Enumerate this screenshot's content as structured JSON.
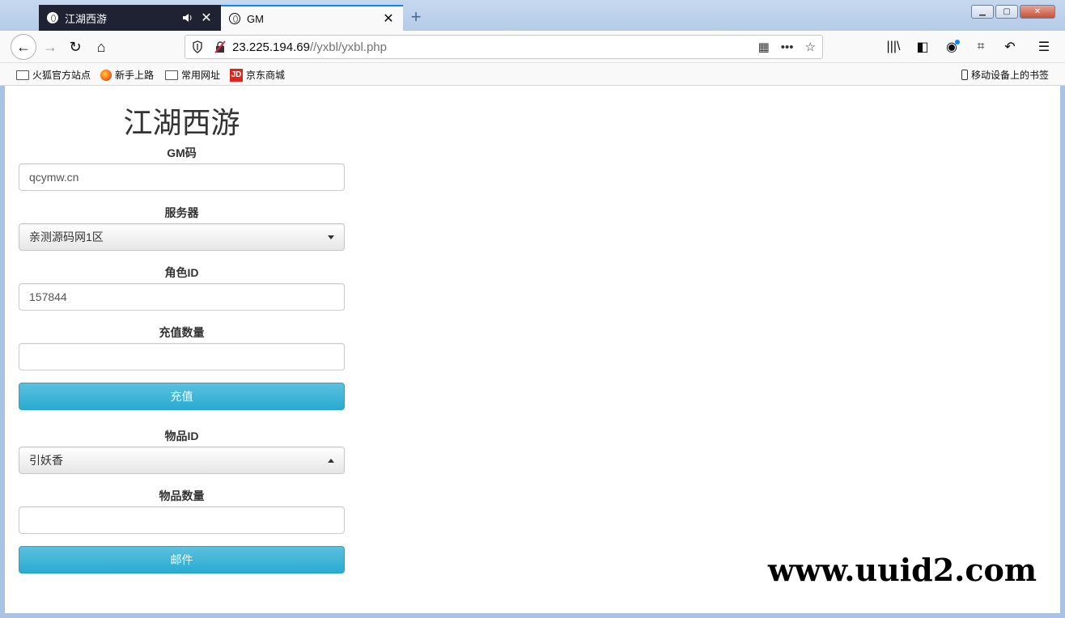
{
  "tabs": [
    {
      "title": "江湖西游",
      "active": false
    },
    {
      "title": "GM",
      "active": true
    }
  ],
  "url": {
    "host": "23.225.194.69",
    "path": "//yxbl/yxbl.php"
  },
  "bookmarks": [
    {
      "label": "火狐官方站点",
      "icon": "folder-icon"
    },
    {
      "label": "新手上路",
      "icon": "firefox-icon"
    },
    {
      "label": "常用网址",
      "icon": "folder-icon"
    },
    {
      "label": "京东商城",
      "icon": "jd-icon"
    }
  ],
  "mobile_bookmarks": "移动设备上的书签",
  "jd_icon_text": "JD",
  "page": {
    "title": "江湖西游",
    "gm_label": "GM码",
    "gm_value": "qcymw.cn",
    "server_label": "服务器",
    "server_value": "亲测源码网1区",
    "role_label": "角色ID",
    "role_value": "157844",
    "amount_label": "充值数量",
    "amount_value": "",
    "recharge_button": "充值",
    "item_label": "物品ID",
    "item_value": "引妖香",
    "item_qty_label": "物品数量",
    "item_qty_value": "",
    "mail_button": "邮件"
  },
  "watermark": "www.uuid2.com",
  "colors": {
    "accent": "#0a84ff",
    "button": "#2aabd2"
  }
}
